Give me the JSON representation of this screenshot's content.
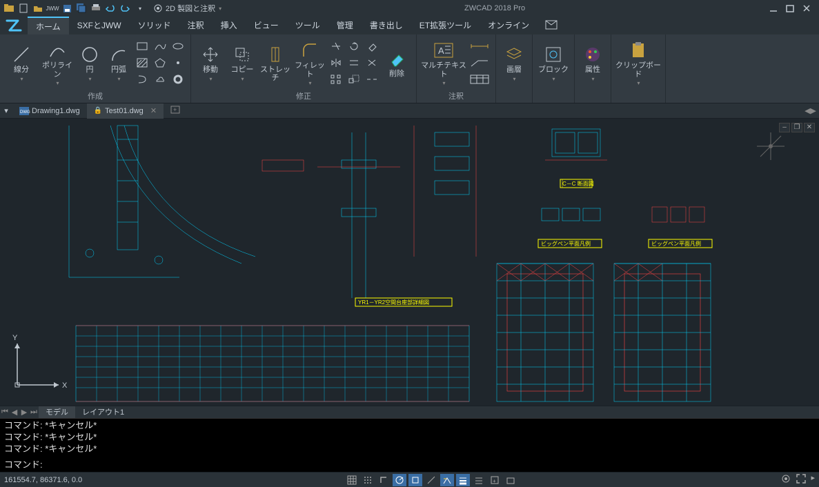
{
  "app": {
    "title": "ZWCAD 2018 Pro",
    "workspace": "2D 製図と注釈"
  },
  "tabs": {
    "items": [
      "ホーム",
      "SXFとJWW",
      "ソリッド",
      "注釈",
      "挿入",
      "ビュー",
      "ツール",
      "管理",
      "書き出し",
      "ET拡張ツール",
      "オンライン"
    ],
    "active": 0
  },
  "ribbon": {
    "panel_create": {
      "title": "作成",
      "line": "線分",
      "polyline": "ポリライン",
      "circle": "円",
      "arc": "円弧"
    },
    "panel_modify": {
      "title": "修正",
      "move": "移動",
      "copy": "コピー",
      "stretch": "ストレッチ",
      "fillet": "フィレット",
      "delete": "削除"
    },
    "panel_annotate": {
      "title": "注釈",
      "mtext": "マルチテキスト",
      "layer": "画層"
    },
    "panel_block": {
      "block": "ブロック"
    },
    "panel_prop": {
      "prop": "属性"
    },
    "panel_clip": {
      "clip": "クリップボード"
    }
  },
  "doctabs": {
    "items": [
      {
        "name": "Drawing1.dwg",
        "locked": false,
        "icon": "dwg"
      },
      {
        "name": "Test01.dwg",
        "locked": true,
        "icon": "dwg"
      }
    ],
    "active": 1
  },
  "drawing": {
    "labels": {
      "section_cc": "C－C 断面図",
      "bigpen1": "ビッグペン平面凡例",
      "bigpen2": "ビッグペン平面凡例",
      "yr_section": "YR1－YR2空間台座部詳細図"
    }
  },
  "layouttabs": {
    "model": "モデル",
    "layout1": "レイアウト1"
  },
  "command": {
    "history": [
      "コマンド: *キャンセル*",
      "コマンド: *キャンセル*",
      "コマンド: *キャンセル*"
    ],
    "prompt": "コマンド: "
  },
  "status": {
    "coords": "161554.7, 86371.6, 0.0"
  }
}
